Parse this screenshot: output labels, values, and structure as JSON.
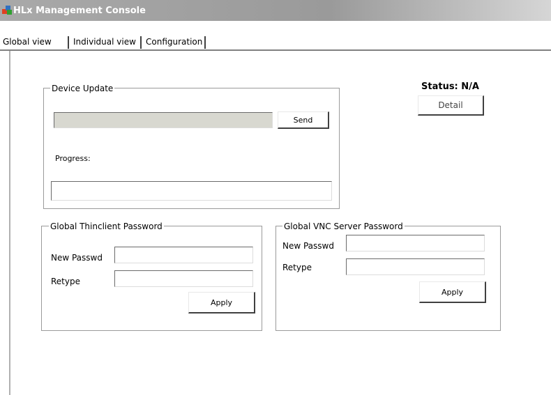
{
  "window": {
    "title": "HLx Management Console",
    "icon": "app-cubes-icon"
  },
  "tabs": [
    {
      "label": "Global view",
      "selected": true
    },
    {
      "label": "Individual view",
      "selected": false
    },
    {
      "label": "Configuration",
      "selected": false
    }
  ],
  "device_update": {
    "legend": "Device Update",
    "send_label": "Send",
    "progress_label": "Progress:",
    "file_value": "",
    "progress_value": ""
  },
  "status": {
    "label": "Status: N/A",
    "detail_label": "Detail"
  },
  "thinclient_password": {
    "legend": "Global Thinclient Password",
    "new_label": "New Passwd",
    "retype_label": "Retype",
    "apply_label": "Apply"
  },
  "vnc_password": {
    "legend": "Global VNC Server Password",
    "new_label": "New Passwd",
    "retype_label": "Retype",
    "apply_label": "Apply"
  },
  "colors": {
    "titlebar": "#9a9a9a",
    "accent_red": "#e04020",
    "accent_blue": "#3070c0",
    "accent_green": "#30a030"
  }
}
